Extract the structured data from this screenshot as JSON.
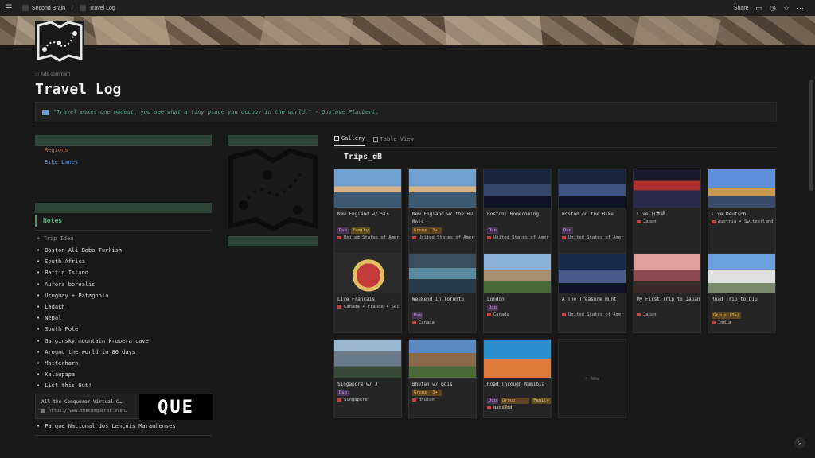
{
  "topbar": {
    "breadcrumb": [
      "Second Brain",
      "Travel Log"
    ],
    "separator": "/",
    "share": "Share",
    "icons": [
      "menu-icon",
      "comment-icon",
      "clock-icon",
      "star-icon",
      "more-icon"
    ]
  },
  "page": {
    "add_comment": "Add comment",
    "title": "Travel Log",
    "quote": "\"Travel makes one modest, you see what a tiny place you occupy in the world.\" - Gustave Flaubert."
  },
  "left": {
    "links": [
      "Regions",
      "Bike Lanes"
    ],
    "notes_heading": "Notes",
    "trip_idea": "Trip Idea",
    "notes": [
      "Boston Ali Baba Turkish",
      "South Africa",
      "Baffin Island",
      "Aurora borealis",
      "Uruguay + Patagonia",
      "Ladakh",
      "Nepal",
      "South Pole",
      "Garginsky mountain krubera cave",
      "Around the world in 80 days",
      "Matterhorn",
      "Kalaupapa",
      "List this Out!"
    ],
    "bookmark": {
      "title": "All the Conqueror Virtual C…",
      "url": "https://www.theconqueror.even…",
      "thumb_text": "QUE"
    },
    "last_note": "Parque Nacional dos Lençóis Maranhenses"
  },
  "gallery": {
    "tabs": [
      "Gallery",
      "Table View"
    ],
    "db_title": "Trips_dB",
    "new_label": "+ New",
    "cards": [
      {
        "title": "New England w/ Sis",
        "tags": [
          "Duo",
          "Family"
        ],
        "loc": "United States of Amer"
      },
      {
        "title": "New England w/ the BU Bois",
        "tags": [
          "Group (3+)"
        ],
        "loc": "United States of Amer"
      },
      {
        "title": "Boston: Homecoming",
        "tags": [
          "Duo"
        ],
        "loc": "United States of Amer"
      },
      {
        "title": "Boston on the Bike",
        "tags": [
          "Duo"
        ],
        "loc": "United States of Amer"
      },
      {
        "title": "Live 日本語",
        "tags": [],
        "loc": "Japan"
      },
      {
        "title": "Live Deutsch",
        "tags": [],
        "loc": "Austria • Switzerland"
      },
      {
        "title": "Live Français",
        "tags": [],
        "loc": "Canada • France • Sei"
      },
      {
        "title": "Weekend in Toronto",
        "tags": [
          "Duo"
        ],
        "loc": "Canada"
      },
      {
        "title": "London",
        "tags": [
          "Duo"
        ],
        "loc": "Canada"
      },
      {
        "title": "A The Treasure Hunt",
        "tags": [],
        "loc": "United States of Amer"
      },
      {
        "title": "My First Trip to Japan",
        "tags": [],
        "loc": "Japan"
      },
      {
        "title": "Road Trip to Diu",
        "tags": [
          "Group (3+)"
        ],
        "loc": "India"
      },
      {
        "title": "Singapore w/ J",
        "tags": [
          "Duo"
        ],
        "loc": "Singapore"
      },
      {
        "title": "Bhutan w/ Bois",
        "tags": [
          "Group (3+)"
        ],
        "loc": "Bhutan"
      },
      {
        "title": "Road Through Namibia",
        "tags": [
          "Duo",
          "Group (3+)",
          "Family"
        ],
        "loc": "Namibia"
      }
    ]
  },
  "help": "?",
  "colors": {
    "background": "#191919",
    "quote_text": "#5fa88c",
    "notes_accent": "#5fb88c",
    "tag_duo": "#4a3458",
    "tag_group": "#5c4520",
    "tag_family": "#5a4a20"
  }
}
